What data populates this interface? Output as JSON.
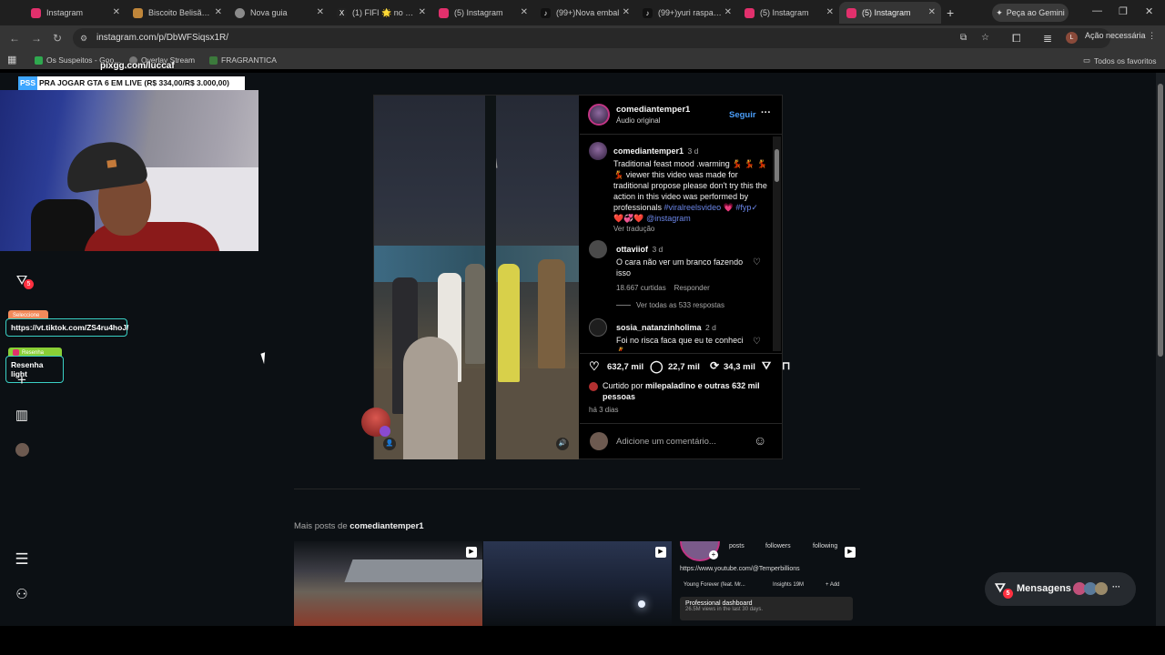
{
  "browser": {
    "tabs": [
      {
        "title": "Instagram",
        "color": "#e1306c"
      },
      {
        "title": "Biscoito Belisão: C",
        "color": "#c0863a"
      },
      {
        "title": "Nova guia",
        "color": "#8a8a8a"
      },
      {
        "title": "(1) FIFI 🌟 no X: \"",
        "color": "#222222"
      },
      {
        "title": "(5) Instagram",
        "color": "#e1306c"
      },
      {
        "title": "(99+)Nova embal",
        "color": "#111111"
      },
      {
        "title": "(99+)yuri raspand",
        "color": "#111111"
      },
      {
        "title": "(5) Instagram",
        "color": "#e1306c"
      },
      {
        "title": "(5) Instagram",
        "color": "#e1306c"
      }
    ],
    "gemini_label": "Peça ao Gemini",
    "url": "instagram.com/p/DbWFSiqsx1R/",
    "action_label": "Ação necessária",
    "profile_initial": "L",
    "bookmarks": [
      "Os Suspeitos - Goo...",
      "Overlay Stream",
      "FRAGRANTICA"
    ],
    "all_favorites": "Todos os favoritos"
  },
  "stream_overlay": {
    "pix": "pixgg.com/luccaf",
    "ticker_tag": "PSS",
    "ticker_text": "PRA JOGAR GTA 6 EM LIVE (R$ 334,00/R$ 3.000,00)",
    "link_label_tag": "Seleccione",
    "link": "https://vt.tiktok.com/ZS4ru4hoJ/",
    "resenha_tag": "Resenha",
    "resenha": "Resenha light",
    "notif_count": "5"
  },
  "post": {
    "author": "comediantemper1",
    "audio": "Áudio original",
    "follow": "Seguir",
    "caption": {
      "user": "comediantemper1",
      "time": "3 d",
      "text": "Traditional feast mood .warming 💃 💃 💃 💃 viewer this video was made for traditional propose please don't try this the action in this video was performed by professionals",
      "tags1": "#viralreelsvideo",
      "tags2": "#fyp✓",
      "mention": "@instagram",
      "translate": "Ver tradução"
    },
    "comments": [
      {
        "user": "ottaviiof",
        "time": "3 d",
        "text": "O cara não ver um branco fazendo isso",
        "likes": "18.667 curtidas",
        "reply": "Responder",
        "view_replies": "Ver todas as 533 respostas"
      },
      {
        "user": "sosia_natanzinholima",
        "time": "2 d",
        "text": "Foi no risca faca que eu te conheci 💃"
      }
    ],
    "likes": "632,7 mil",
    "comment_count": "22,7 mil",
    "reposts": "34,3 mil",
    "liked_by_prefix": "Curtido por",
    "liked_by_user": "milepaladino",
    "liked_by_suffix": "e outras 632 mil pessoas",
    "ago": "há 3 dias",
    "add_comment": "Adicione um comentário..."
  },
  "more_posts": {
    "prefix": "Mais posts de",
    "user": "comediantemper1",
    "profile_card": {
      "posts": "posts",
      "followers": "followers",
      "following": "following",
      "link": "https://www.youtube.com/@Temperbillions",
      "music": "Young Forever (feat. Mr...",
      "insights": "Insights",
      "insights_count": "19M",
      "add": "+ Add",
      "dashboard": "Professional dashboard",
      "dashboard_sub": "26.5M views in the last 30 days."
    }
  },
  "messages": {
    "label": "Mensagens",
    "count": "5"
  }
}
